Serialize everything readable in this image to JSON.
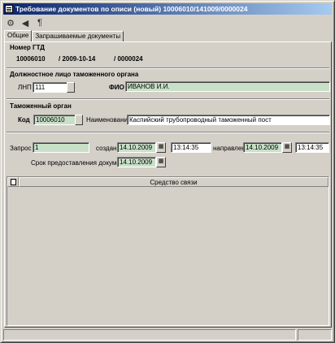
{
  "window": {
    "title": "Требование документов по описи (новый) 10006010/141009/0000024"
  },
  "toolbar": {
    "buttons": [
      {
        "icon": "gear-icon",
        "glyph": "⚙"
      },
      {
        "icon": "back-arrow-icon",
        "glyph": "◀"
      },
      {
        "icon": "paragraph-icon",
        "glyph": "¶"
      }
    ]
  },
  "tabs": [
    "Общие",
    "Запрашиваемые документы"
  ],
  "gtd": {
    "label": "Номер ГТД",
    "code": "10006010",
    "date": "/ 2009-10-14",
    "number": "/ 0000024"
  },
  "official": {
    "section_label": "Должностное лицо таможенного органа",
    "lnp_label": "ЛНП",
    "lnp_value": "111",
    "fio_label": "ФИО",
    "fio_value": "ИВАНОВ И.И."
  },
  "customs": {
    "section_label": "Таможенный орган",
    "code_label": "Код",
    "code_value": "10006010",
    "name_label": "Наименование",
    "name_value": "Каспийский трубопроводный таможенный пост"
  },
  "request": {
    "label": "Запрос",
    "value": "1",
    "created_label": "создан",
    "created_date": "14.10.2009",
    "created_time": "13:14:35",
    "sent_label": "направлен",
    "sent_date": "14.10.2009",
    "sent_time": "13:14:35",
    "deadline_label": "Срок предоставления документов",
    "deadline_date": "14.10.2009"
  },
  "grid": {
    "columns": [
      "Средство связи"
    ]
  },
  "colors": {
    "title_start": "#0a246a",
    "title_end": "#a6caf0",
    "readonly_field": "#c8e0c8",
    "window_bg": "#d4d0c8"
  }
}
